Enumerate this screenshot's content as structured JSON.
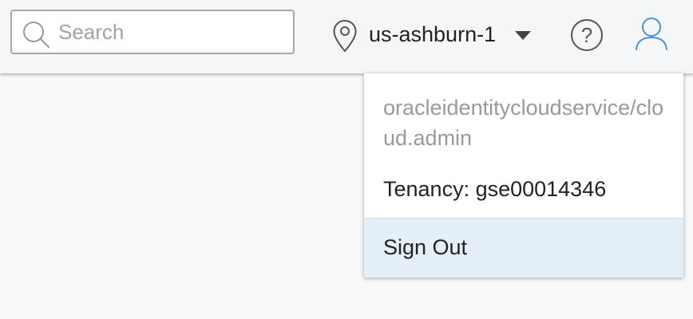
{
  "header": {
    "search": {
      "placeholder": "Search",
      "value": "",
      "icon": "search-icon"
    },
    "region": {
      "label": "us-ashburn-1",
      "icon": "location-pin-icon",
      "caret": "chevron-down-icon"
    },
    "help": {
      "icon": "help-icon"
    },
    "user": {
      "icon": "user-icon",
      "color": "#4a90d9"
    }
  },
  "user_menu": {
    "username": "oracleidentitycloudservice/cloud.admin",
    "tenancy": "Tenancy: gse00014346",
    "sign_out": "Sign Out",
    "sign_out_bg": "#e4eff9"
  }
}
